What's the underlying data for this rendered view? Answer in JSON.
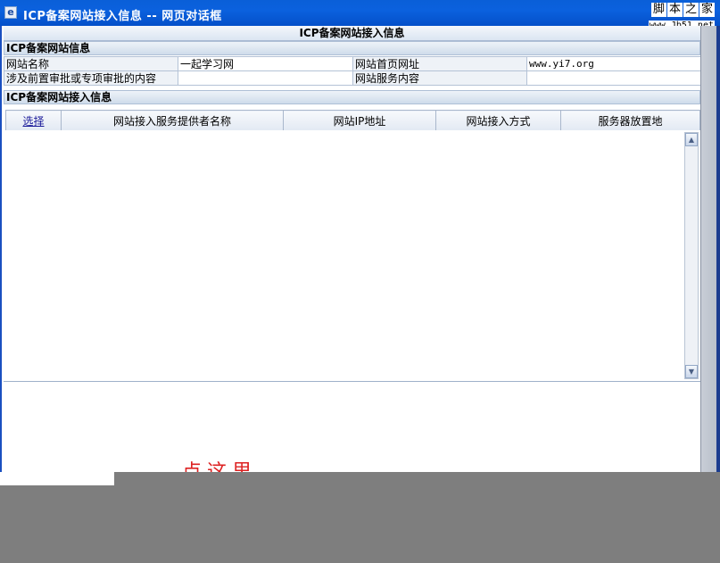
{
  "window": {
    "title": "ICP备案网站接入信息  --  网页对话框",
    "icon": "ie-icon",
    "watermark_chars": [
      "脚",
      "本",
      "之",
      "家"
    ],
    "watermark_url": "www.Jb51.net"
  },
  "dialog": {
    "header": "ICP备案网站接入信息"
  },
  "site_info": {
    "section_title": "ICP备案网站信息",
    "rows": [
      {
        "label1": "网站名称",
        "value1": "一起学习网",
        "label2": "网站首页网址",
        "value2": "www.yi7.org"
      },
      {
        "label1": "涉及前置审批或专项审批的内容",
        "value1": "",
        "label2": "网站服务内容",
        "value2": ""
      }
    ]
  },
  "access_info": {
    "section_title": "ICP备案网站接入信息",
    "columns": [
      "选择",
      "网站接入服务提供者名称",
      "网站IP地址",
      "网站接入方式",
      "服务器放置地"
    ]
  },
  "footer": {
    "partial_text": "点这里"
  }
}
